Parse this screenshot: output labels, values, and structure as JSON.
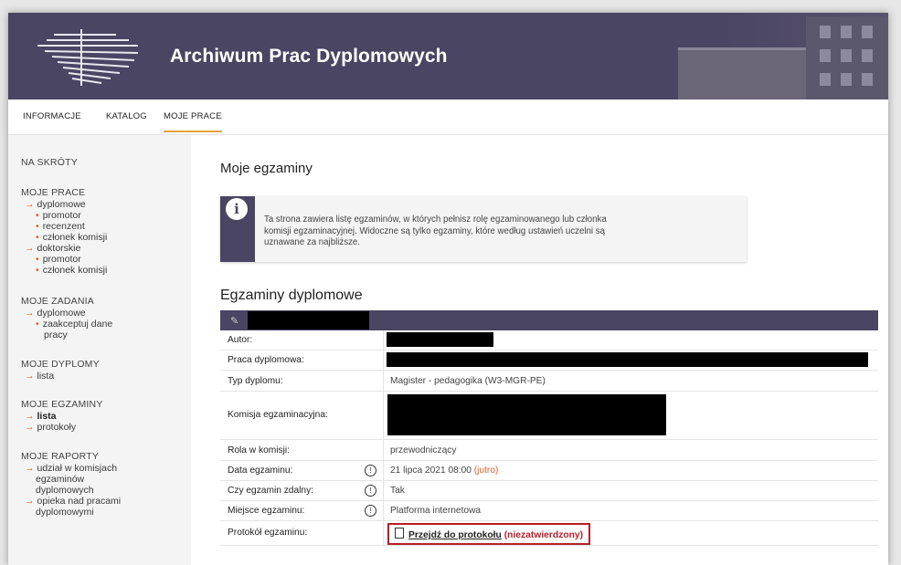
{
  "app": {
    "title": "Archiwum Prac Dyplomowych"
  },
  "topnav": [
    "INFORMACJE",
    "KATALOG",
    "MOJE PRACE"
  ],
  "sidebar": {
    "shortcuts": "NA SKRÓTY",
    "prace": {
      "head": "MOJE PRACE",
      "dyplomowe": "dyplomowe",
      "promotor": "promotor",
      "recenzent": "recenzent",
      "czlonek": "członek komisji",
      "doktorskie": "doktorskie",
      "promotor2": "promotor",
      "czlonek2": "członek komisji"
    },
    "zadania": {
      "head": "MOJE ZADANIA",
      "dyplomowe": "dyplomowe",
      "zaakceptuj1": "zaakceptuj dane",
      "zaakceptuj2": "pracy"
    },
    "dyplomy": {
      "head": "MOJE DYPLOMY",
      "lista": "lista"
    },
    "egzaminy": {
      "head": "MOJE EGZAMINY",
      "lista": "lista",
      "protokoly": "protokoły"
    },
    "raporty": {
      "head": "MOJE RAPORTY",
      "udzial1": "udział w komisjach",
      "udzial2": "egzaminów",
      "udzial3": "dyplomowych",
      "opieka1": "opieka nad pracami",
      "opieka2": "dyplomowymi"
    }
  },
  "main": {
    "title": "Moje egzaminy",
    "info_lines": [
      "Ta strona zawiera listę egzaminów, w których pełnisz rolę egzaminowanego lub członka",
      "komisji egzaminacyjnej. Widoczne są tylko egzaminy, które według ustawień uczelni są",
      "uznawane za najbliższe."
    ],
    "section": "Egzaminy dyplomowe",
    "rows": {
      "autor": "Autor:",
      "praca": "Praca dyplomowa:",
      "typ": "Typ dyplomu:",
      "typ_val": "Magister - pedagogika (W3-MGR-PE)",
      "komisja": "Komisja egzaminacyjna:",
      "rola": "Rola w komisji:",
      "rola_val": "przewodniczący",
      "data": "Data egzaminu:",
      "data_val": "21 lipca 2021 08:00",
      "data_soon": "(jutro)",
      "zdalny": "Czy egzamin zdalny:",
      "zdalny_val": "Tak",
      "miejsce": "Miejsce egzaminu:",
      "miejsce_val": "Platforma internetowa",
      "protokol": "Protokół egzaminu:",
      "protokol_link": "Przejdź do protokołu",
      "protokol_status": "(niezatwierdzony)"
    }
  }
}
